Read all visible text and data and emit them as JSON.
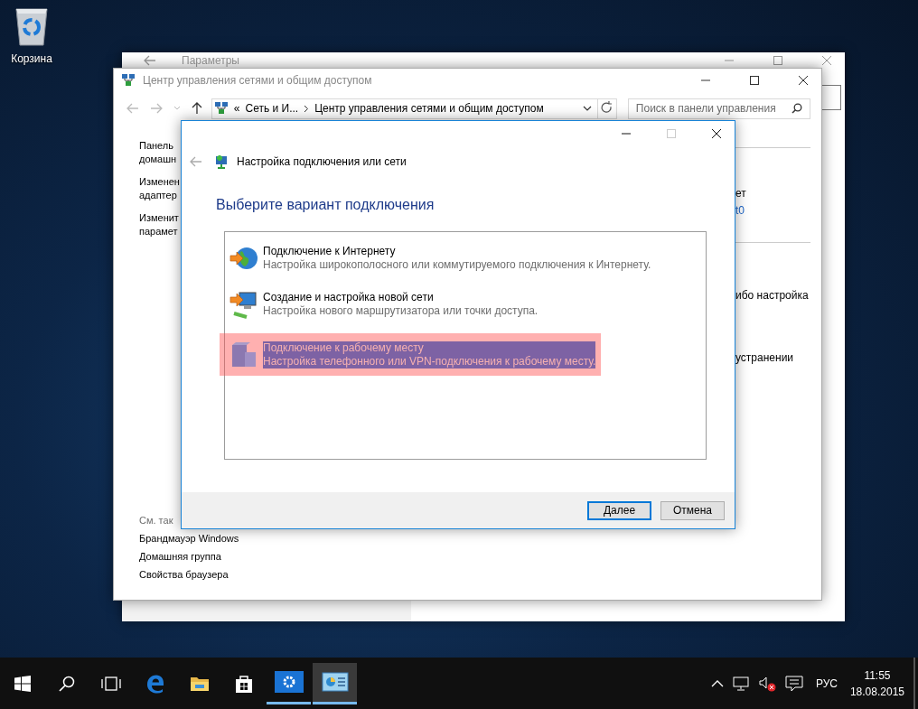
{
  "desktop_icons": [
    {
      "label": "Корзина"
    }
  ],
  "back_window": {
    "title": "Параметры"
  },
  "main_window": {
    "title": "Центр управления сетями и общим доступом",
    "address": {
      "overflow": "«",
      "items": [
        "Сеть и И...",
        "Центр управления сетями и общим доступом"
      ]
    },
    "search": {
      "placeholder": "Поиск в панели управления"
    },
    "sidebar_links": [
      {
        "lines": [
          "Панель",
          "домашн"
        ]
      },
      {
        "lines": [
          "Изменен",
          "адаптер"
        ]
      },
      {
        "lines": [
          "Изменит",
          "парамет"
        ]
      }
    ],
    "see_also": {
      "heading": "См. так",
      "links": [
        "Брандмауэр Windows",
        "Домашняя группа",
        "Свойства браузера"
      ]
    },
    "right_fragments": [
      {
        "text": "ет",
        "kind": "text"
      },
      {
        "text": "t0",
        "kind": "link"
      },
      {
        "text": "ибо настройка",
        "kind": "text"
      },
      {
        "text": "устранении",
        "kind": "text"
      }
    ]
  },
  "dialog": {
    "title": "Настройка подключения или сети",
    "heading": "Выберите вариант подключения",
    "options": [
      {
        "kind": "internet",
        "title": "Подключение к Интернету",
        "description": "Настройка широкополосного или коммутируемого подключения к Интернету.",
        "selected": false
      },
      {
        "kind": "network",
        "title": "Создание и настройка новой сети",
        "description": "Настройка нового маршрутизатора или точки доступа.",
        "selected": false
      },
      {
        "kind": "workplace",
        "title": "Подключение к рабочему месту",
        "description": "Настройка телефонного или VPN-подключения к рабочему месту.",
        "selected": true
      }
    ],
    "buttons": [
      {
        "label": "Далее",
        "default": true
      },
      {
        "label": "Отмена",
        "default": false
      }
    ]
  },
  "taskbar": {
    "apps": [
      {
        "kind": "start",
        "active": false,
        "focused": false
      },
      {
        "kind": "search",
        "active": false,
        "focused": false
      },
      {
        "kind": "taskview",
        "active": false,
        "focused": false
      },
      {
        "kind": "edge",
        "active": false,
        "focused": false
      },
      {
        "kind": "explorer",
        "active": false,
        "focused": false
      },
      {
        "kind": "store",
        "active": false,
        "focused": false
      },
      {
        "kind": "settings",
        "active": true,
        "focused": false
      },
      {
        "kind": "controlpanel",
        "active": true,
        "focused": true
      }
    ],
    "language": "РУС",
    "time": "11:55",
    "date": "18.08.2015"
  }
}
